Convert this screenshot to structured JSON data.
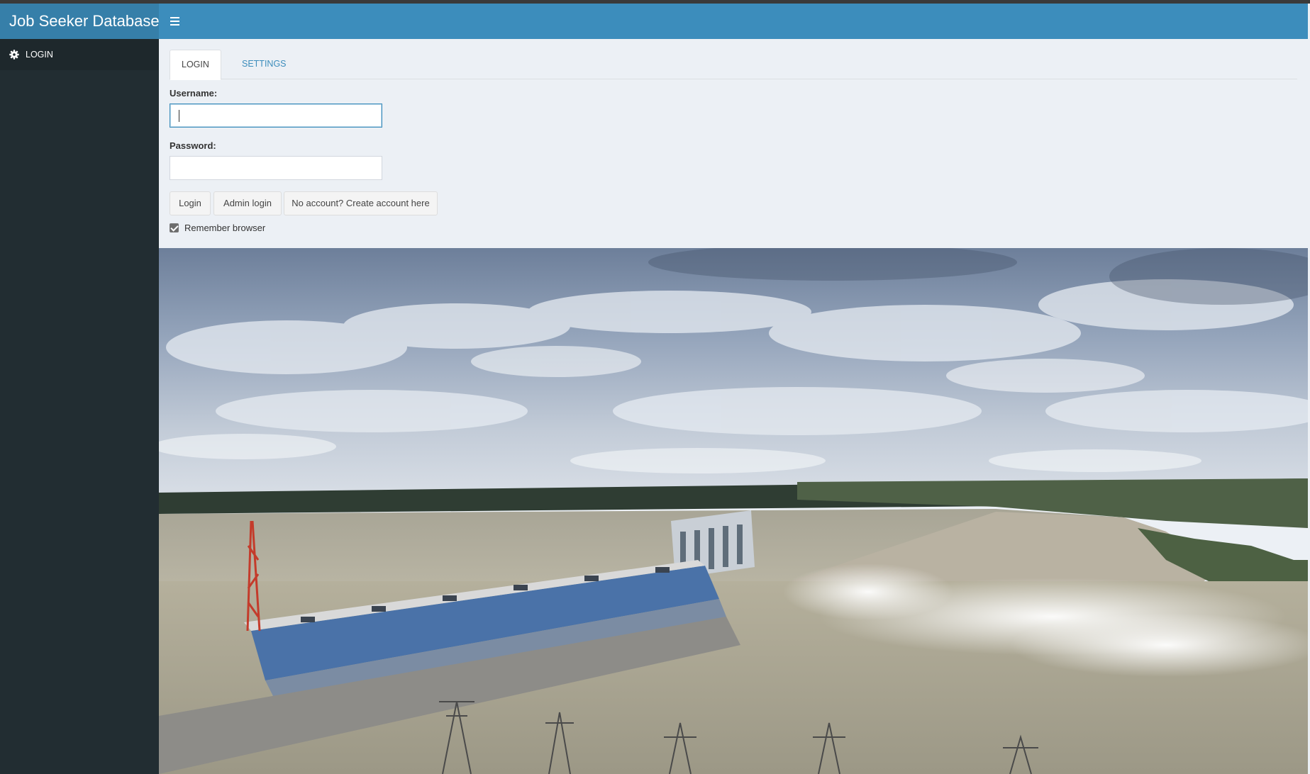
{
  "app": {
    "title": "Job Seeker Database"
  },
  "navbar": {
    "toggle_icon": "hamburger-menu-icon"
  },
  "sidebar": {
    "items": [
      {
        "label": "LOGIN",
        "icon": "gear-icon"
      }
    ]
  },
  "tabs": [
    {
      "label": "LOGIN",
      "active": true
    },
    {
      "label": "SETTINGS",
      "active": false
    }
  ],
  "form": {
    "username": {
      "label": "Username:",
      "value": ""
    },
    "password": {
      "label": "Password:",
      "value": ""
    },
    "buttons": {
      "login": "Login",
      "admin_login": "Admin login",
      "create_account": "No account? Create account here"
    },
    "remember": {
      "label": "Remember browser",
      "checked": true
    }
  },
  "colors": {
    "header": "#3c8dbc",
    "logo": "#367fa9",
    "sidebar": "#222d32",
    "sidebar_active": "#1e282c",
    "body": "#ecf0f5"
  },
  "hero": {
    "subject": "hydroelectric-dam-photo"
  }
}
